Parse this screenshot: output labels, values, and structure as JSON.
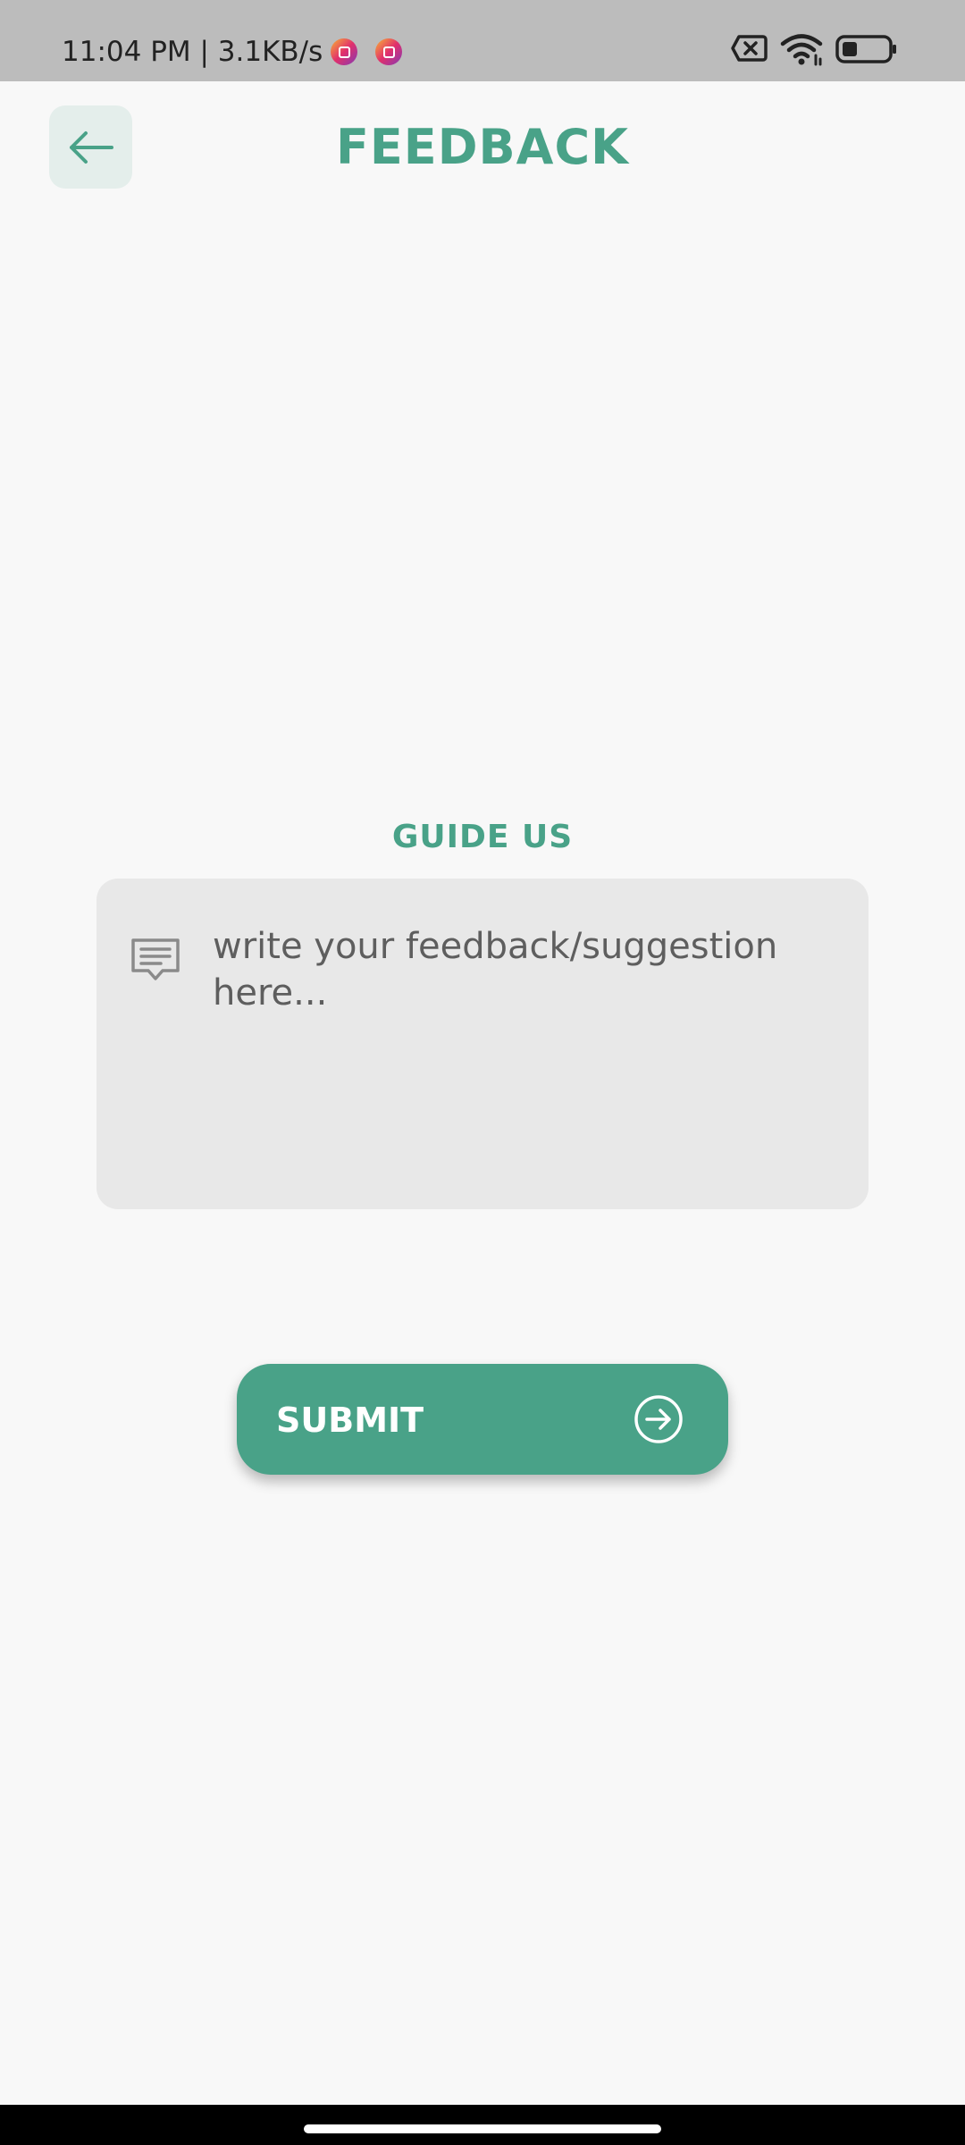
{
  "status_bar": {
    "time_text": "11:04 PM | 3.1KB/s",
    "notification_icons": [
      "instagram-icon",
      "instagram-icon"
    ],
    "right_icons": [
      "sim-error-icon",
      "wifi-icon",
      "battery-icon"
    ]
  },
  "header": {
    "title": "FEEDBACK",
    "back_icon": "arrow-left-icon"
  },
  "feedback": {
    "heading": "GUIDE US",
    "input_value": "",
    "placeholder": "write your feedback/suggestion here...",
    "icon": "message-icon"
  },
  "submit": {
    "label": "SUBMIT",
    "icon": "arrow-right-circle-icon"
  },
  "colors": {
    "accent": "#49a288",
    "background": "#f8f8f8",
    "status_bar": "#bcbcbc",
    "input_background": "#e8e8e8",
    "back_button_background": "#e4eeeb"
  }
}
